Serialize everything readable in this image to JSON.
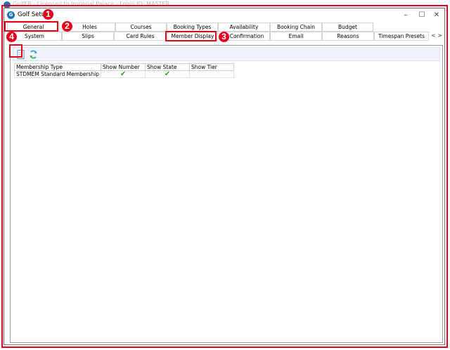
{
  "background_window": {
    "title": "GolfER - Licensed to Imperial Palace - Login ID: MASTER"
  },
  "dialog": {
    "title": "Golf Setup",
    "controls": {
      "minimize": "–",
      "maximize": "☐",
      "close": "✕"
    }
  },
  "tabs_row1": [
    {
      "label": "General",
      "selected": true
    },
    {
      "label": "Holes"
    },
    {
      "label": "Courses"
    },
    {
      "label": "Booking Types"
    },
    {
      "label": "Availability"
    },
    {
      "label": "Booking Chain"
    },
    {
      "label": "Budget"
    }
  ],
  "tabs_row2": [
    {
      "label": "System"
    },
    {
      "label": "Slips"
    },
    {
      "label": "Card Rules"
    },
    {
      "label": "Member Display",
      "selected": true
    },
    {
      "label": "Confirmation"
    },
    {
      "label": "Email"
    },
    {
      "label": "Reasons"
    },
    {
      "label": "Timespan Presets"
    }
  ],
  "tab_scroll": {
    "left": "<",
    "right": ">"
  },
  "callouts": [
    "1",
    "2",
    "3",
    "4"
  ],
  "toolbar": {
    "buttons": [
      {
        "icon": "new-document-icon"
      },
      {
        "icon": "refresh-icon"
      }
    ]
  },
  "grid": {
    "columns": [
      "Membership Type",
      "Show Number",
      "Show State",
      "Show Tier"
    ],
    "rows": [
      {
        "membership_type": "STDMEM Standard Membership",
        "show_number": "✔",
        "show_state": "✔",
        "show_tier": ""
      }
    ]
  },
  "colors": {
    "annotation_red": "#e3001b",
    "check_green": "#3a9a2e",
    "toolbar_bg": "#eef3fa",
    "app_icon_blue": "#1f72b8"
  }
}
